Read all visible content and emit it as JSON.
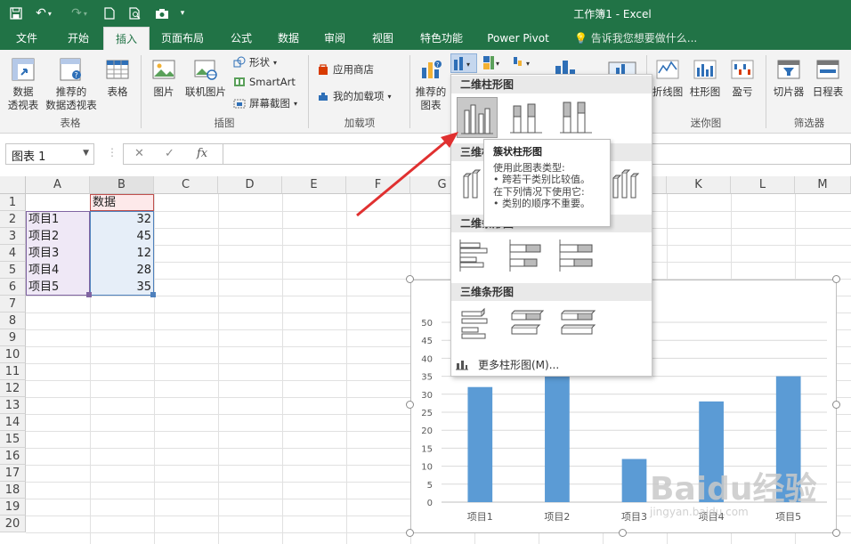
{
  "titlebar": {
    "title": "工作簿1 - Excel"
  },
  "tabs": [
    "文件",
    "开始",
    "插入",
    "页面布局",
    "公式",
    "数据",
    "审阅",
    "视图",
    "特色功能",
    "Power Pivot"
  ],
  "tell_me": "告诉我您想要做什么...",
  "ribbon": {
    "pivot": "数据\n透视表",
    "rec_pivot": "推荐的\n数据透视表",
    "table": "表格",
    "group_tables": "表格",
    "picture": "图片",
    "online_picture": "联机图片",
    "shapes": "形状",
    "smartart": "SmartArt",
    "screenshot": "屏幕截图",
    "group_illustrations": "插图",
    "store": "应用商店",
    "my_addins": "我的加载项",
    "group_addins": "加载项",
    "rec_charts": "推荐的\n图表",
    "line": "折线图",
    "column": "柱形图",
    "winloss": "盈亏",
    "group_spark": "迷你图",
    "slicer": "切片器",
    "timeline": "日程表",
    "group_filter": "筛选器"
  },
  "namebox": "图表 1",
  "fx": "fx",
  "columns": [
    "A",
    "B",
    "C",
    "D",
    "E",
    "F",
    "G",
    "H",
    "I",
    "J",
    "K",
    "L",
    "M"
  ],
  "rows": [
    "1",
    "2",
    "3",
    "4",
    "5",
    "6",
    "7",
    "8",
    "9",
    "10",
    "11",
    "12",
    "13",
    "14",
    "15",
    "16",
    "17",
    "18",
    "19",
    "20"
  ],
  "sheet": {
    "header_b1": "数据",
    "items": [
      {
        "label": "项目1",
        "value": "32"
      },
      {
        "label": "项目2",
        "value": "45"
      },
      {
        "label": "项目3",
        "value": "12"
      },
      {
        "label": "项目4",
        "value": "28"
      },
      {
        "label": "项目5",
        "value": "35"
      }
    ]
  },
  "dropdown": {
    "sec1": "二维柱形图",
    "sec2": "三维柱形图",
    "sec3": "二维条形图",
    "sec4": "三维条形图",
    "more": "更多柱形图(M)..."
  },
  "tooltip": {
    "title": "簇状柱形图",
    "line1": "使用此图表类型:",
    "line2": "• 跨若干类别比较值。",
    "line3": "在下列情况下使用它:",
    "line4": "• 类别的顺序不重要。"
  },
  "chart_data": {
    "type": "bar",
    "categories": [
      "项目1",
      "项目2",
      "项目3",
      "项目4",
      "项目5"
    ],
    "values": [
      32,
      45,
      12,
      28,
      35
    ],
    "title": "",
    "ylim": [
      0,
      50
    ],
    "yticks": [
      "0",
      "5",
      "10",
      "15",
      "20",
      "25",
      "30",
      "35",
      "40",
      "45",
      "50"
    ],
    "grid": true,
    "bar_color": "#5b9bd5"
  },
  "watermark": {
    "text": "Baidu经验",
    "sub": "jingyan.baidu.com"
  },
  "colors": {
    "accent": "#217346",
    "arrow": "#e03030"
  }
}
